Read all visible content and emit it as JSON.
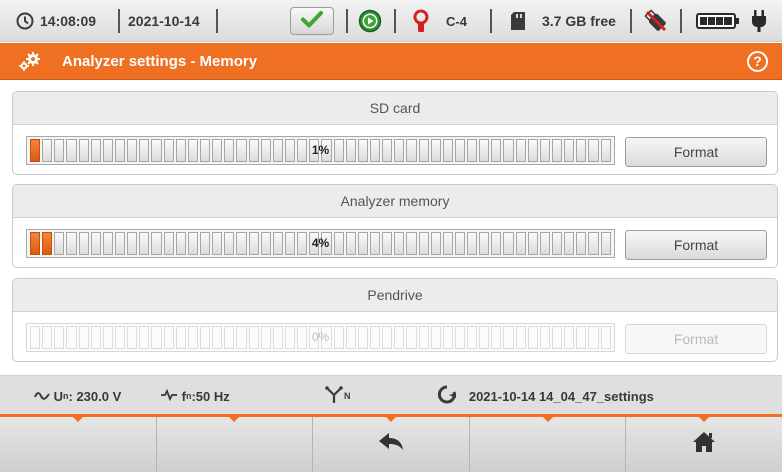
{
  "status_bar": {
    "time": "14:08:09",
    "date": "2021-10-14",
    "clamp": "C-4",
    "free_space": "3.7 GB free",
    "icons": [
      "clock-icon",
      "checkmark-icon",
      "play-icon",
      "clamp-icon",
      "sd-card-icon",
      "usb-disconnected-icon",
      "battery-icon",
      "plug-icon"
    ]
  },
  "title_bar": {
    "title": "Analyzer settings - Memory",
    "help": "?"
  },
  "panels": [
    {
      "title": "SD card",
      "usage": "1%",
      "filled_fraction": 0.01,
      "enabled": true,
      "button": "Format"
    },
    {
      "title": "Analyzer memory",
      "usage": "4%",
      "filled_fraction": 0.04,
      "enabled": true,
      "button": "Format"
    },
    {
      "title": "Pendrive",
      "usage": "0%",
      "filled_fraction": 0.0,
      "enabled": false,
      "button": "Format"
    }
  ],
  "info_bar": {
    "voltage_symbol": "U",
    "voltage_sub": "n",
    "voltage_value": ": 230.0 V",
    "frequency_symbol": "f",
    "frequency_sub": "n",
    "frequency_value": ":50 Hz",
    "network_sub": "N",
    "settings_file": "2021-10-14 14_04_47_settings"
  },
  "softkeys": [
    "",
    "",
    "back-arrow-icon",
    "",
    "home-icon"
  ],
  "colors": {
    "accent": "#ef7023",
    "bar_fill": "#ef7023",
    "ok_green": "#3fa535"
  }
}
